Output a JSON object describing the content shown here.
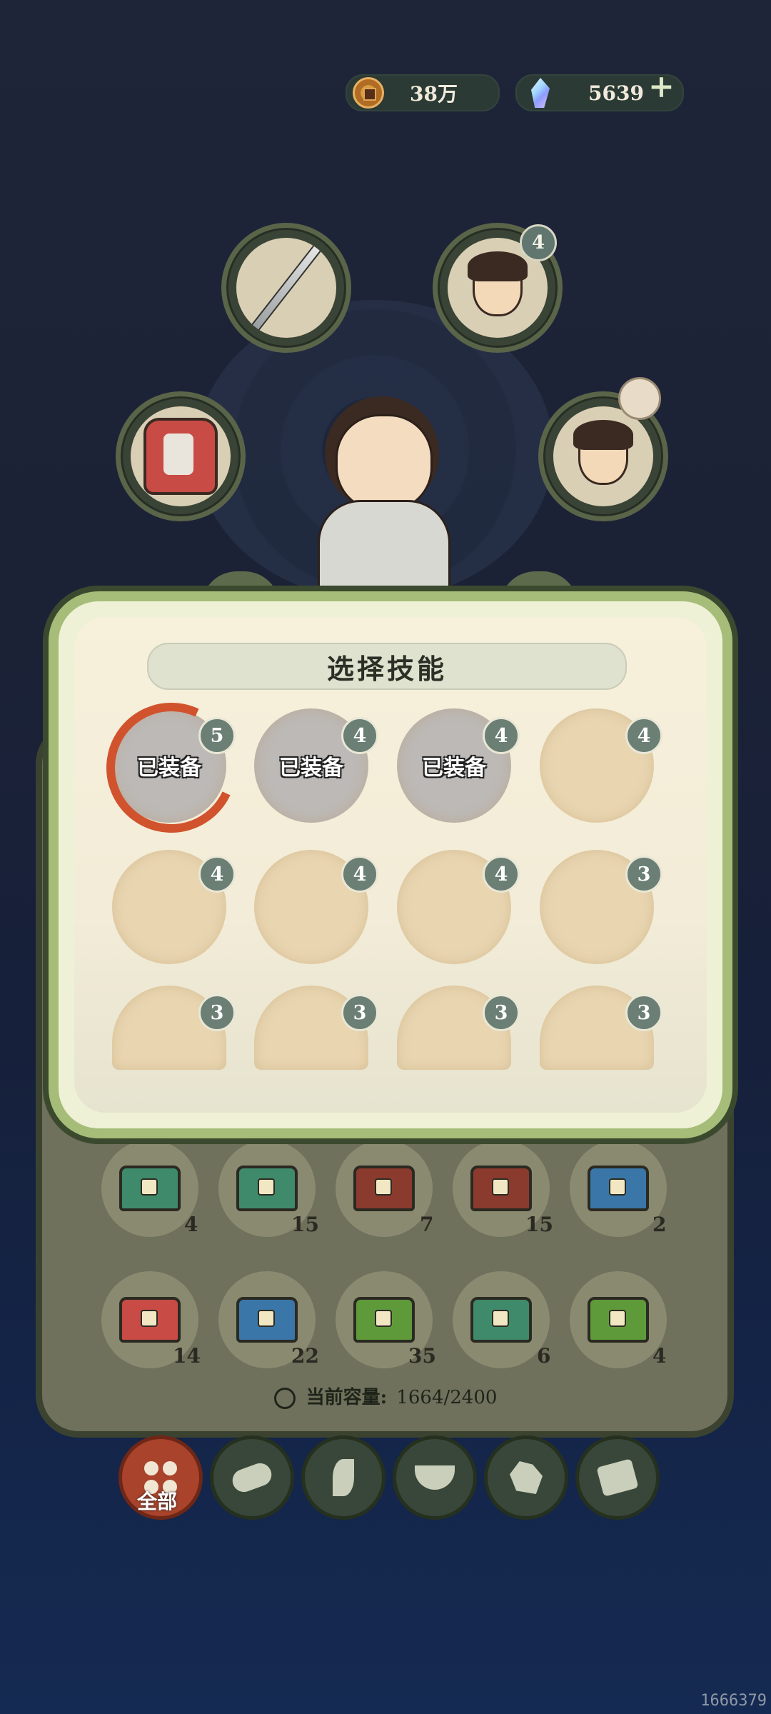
{
  "currency": {
    "coins": "38万",
    "gems": "5639",
    "add_label": "+"
  },
  "equipment": {
    "top_right_count": "4",
    "slots": [
      "sword-icon",
      "yellow-portrait-icon",
      "armor-icon",
      "blue-portrait-icon"
    ]
  },
  "skill_panel": {
    "title": "选择技能",
    "equipped_label": "已装备",
    "skills": [
      {
        "count": "5",
        "equipped": true
      },
      {
        "count": "4",
        "equipped": true
      },
      {
        "count": "4",
        "equipped": true
      },
      {
        "count": "4",
        "equipped": false
      },
      {
        "count": "4",
        "equipped": false
      },
      {
        "count": "4",
        "equipped": false
      },
      {
        "count": "4",
        "equipped": false
      },
      {
        "count": "3",
        "equipped": false
      },
      {
        "count": "3",
        "equipped": false
      },
      {
        "count": "3",
        "equipped": false
      },
      {
        "count": "3",
        "equipped": false
      },
      {
        "count": "3",
        "equipped": false
      }
    ]
  },
  "inventory": {
    "items": [
      {
        "qty": "4",
        "color": "#3f8a6a"
      },
      {
        "qty": "15",
        "color": "#3f8a6a"
      },
      {
        "qty": "7",
        "color": "#8a3b2e"
      },
      {
        "qty": "15",
        "color": "#8a3b2e"
      },
      {
        "qty": "2",
        "color": "#3a76a8"
      },
      {
        "qty": "14",
        "color": "#c84b45"
      },
      {
        "qty": "22",
        "color": "#3a76a8"
      },
      {
        "qty": "35",
        "color": "#5f9a3a"
      },
      {
        "qty": "6",
        "color": "#3f8a6a"
      },
      {
        "qty": "4",
        "color": "#5f9a3a"
      }
    ],
    "capacity_label": "当前容量:",
    "capacity_value": "1664/2400"
  },
  "tabs": {
    "active_label": "全部",
    "icons": [
      "grid-icon",
      "log-icon",
      "herb-icon",
      "bowl-icon",
      "ore-icon",
      "scroll-icon"
    ]
  },
  "user_id": "1666379"
}
